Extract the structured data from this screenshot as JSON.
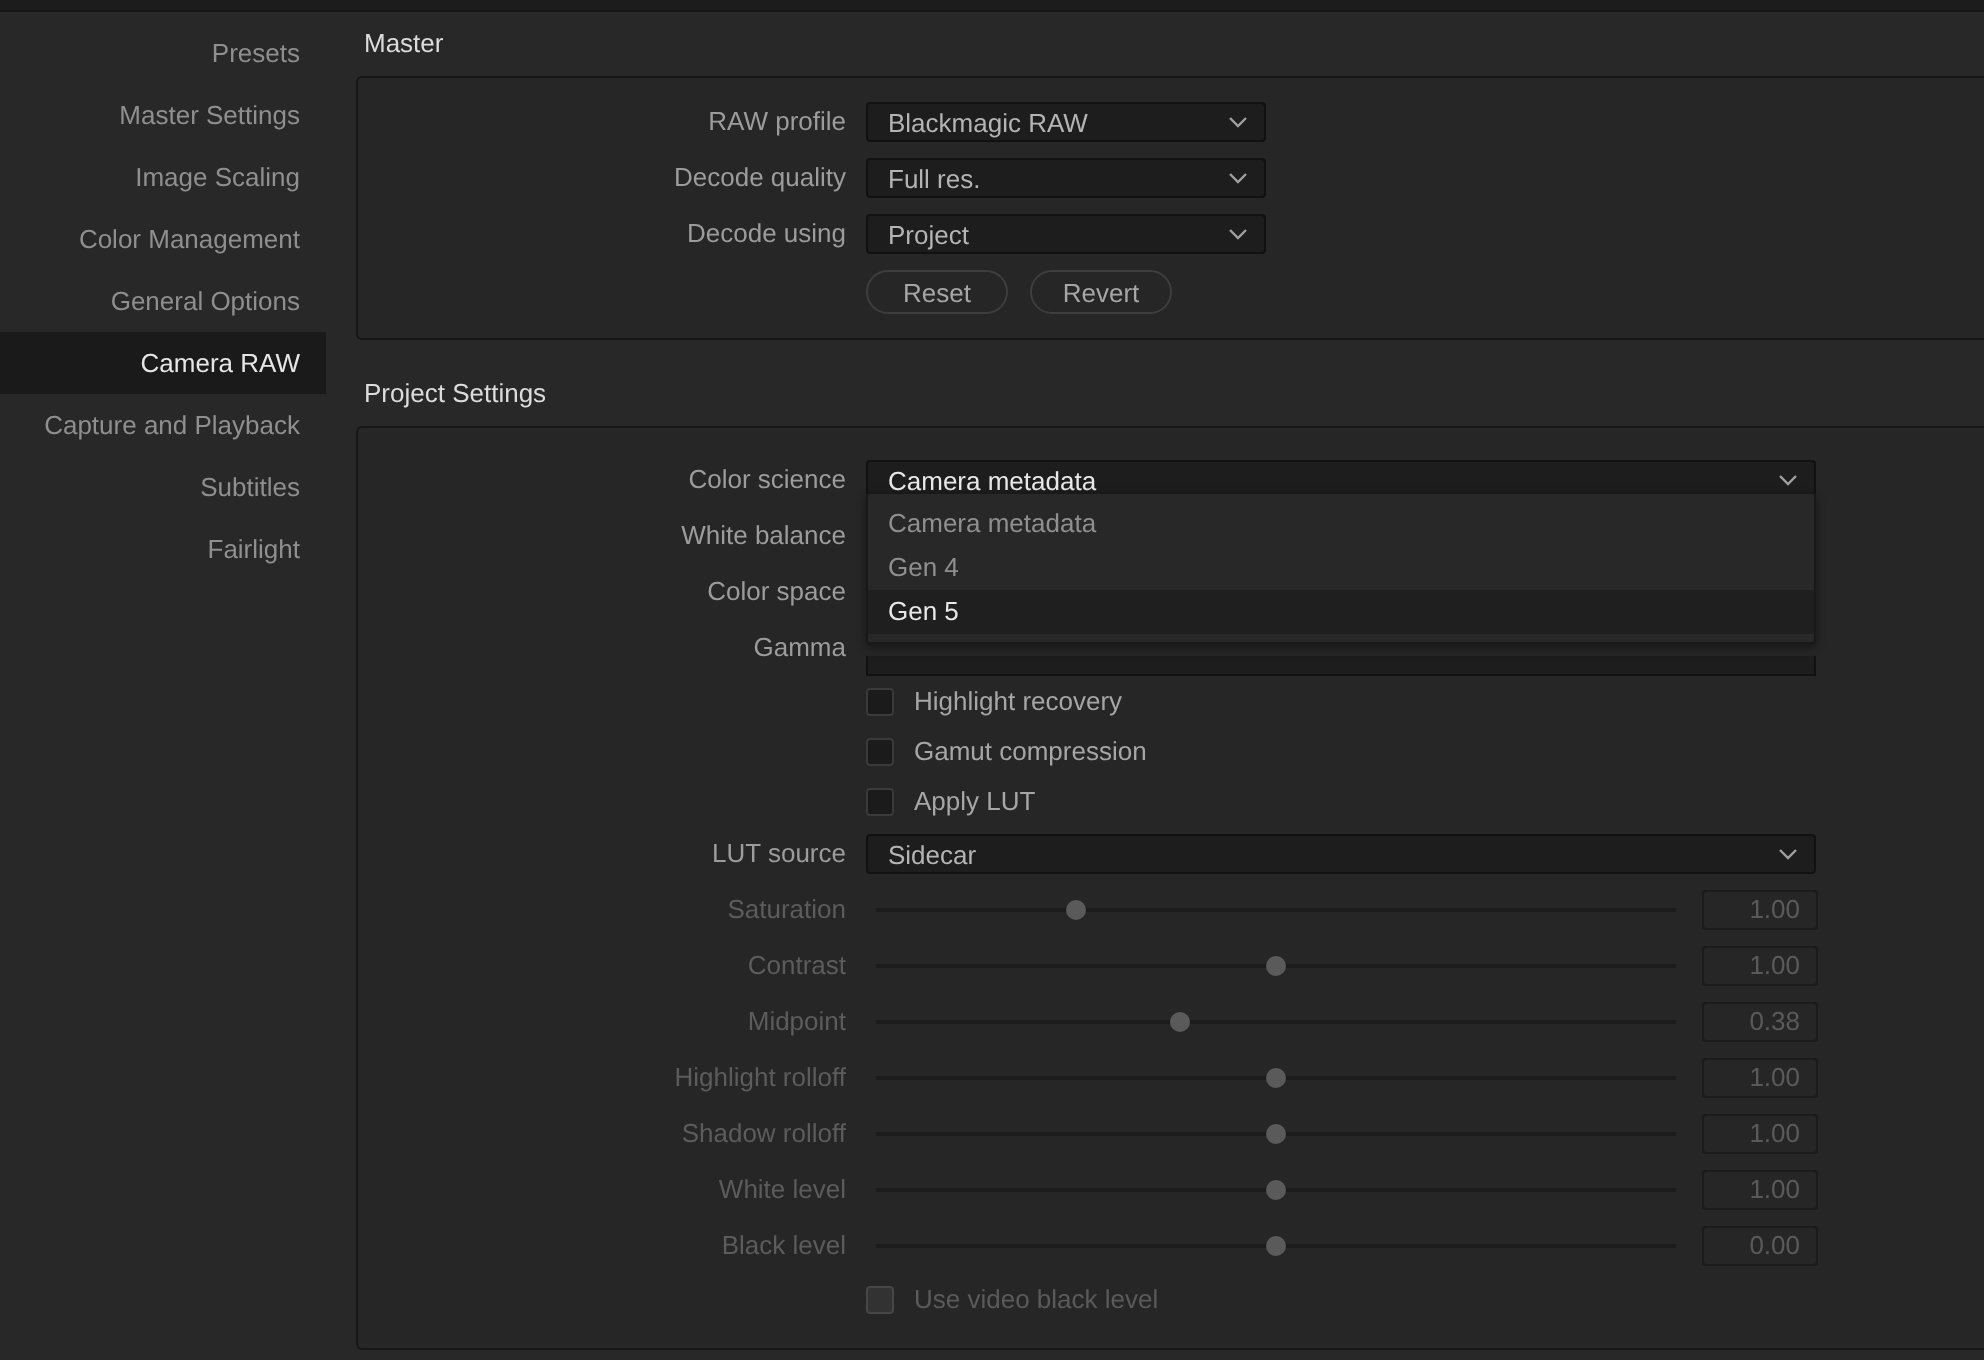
{
  "sidebar": {
    "items": [
      {
        "label": "Presets",
        "selected": false
      },
      {
        "label": "Master Settings",
        "selected": false
      },
      {
        "label": "Image Scaling",
        "selected": false
      },
      {
        "label": "Color Management",
        "selected": false
      },
      {
        "label": "General Options",
        "selected": false
      },
      {
        "label": "Camera RAW",
        "selected": true
      },
      {
        "label": "Capture and Playback",
        "selected": false
      },
      {
        "label": "Subtitles",
        "selected": false
      },
      {
        "label": "Fairlight",
        "selected": false
      }
    ]
  },
  "master": {
    "title": "Master",
    "rows": [
      {
        "label": "RAW profile",
        "value": "Blackmagic RAW"
      },
      {
        "label": "Decode quality",
        "value": "Full res."
      },
      {
        "label": "Decode using",
        "value": "Project"
      }
    ],
    "buttons": [
      "Reset",
      "Revert"
    ]
  },
  "project_settings": {
    "title": "Project Settings",
    "rows": [
      {
        "kind": "dropdown",
        "label": "Color science",
        "value": "Camera metadata",
        "open": true,
        "options": [
          {
            "label": "Camera metadata",
            "highlighted": false
          },
          {
            "label": "Gen 4",
            "highlighted": false
          },
          {
            "label": "Gen 5",
            "highlighted": true
          }
        ]
      },
      {
        "kind": "covered",
        "label": "White balance"
      },
      {
        "kind": "covered",
        "label": "Color space"
      },
      {
        "kind": "covered",
        "label": "Gamma"
      },
      {
        "kind": "checkbox",
        "label": "Highlight recovery",
        "checked": false,
        "disabled": false
      },
      {
        "kind": "checkbox",
        "label": "Gamut compression",
        "checked": false,
        "disabled": false
      },
      {
        "kind": "checkbox",
        "label": "Apply LUT",
        "checked": false,
        "disabled": false
      },
      {
        "kind": "dropdown",
        "label": "LUT source",
        "value": "Sidecar",
        "open": false
      },
      {
        "kind": "slider",
        "label": "Saturation",
        "level": 0.25,
        "reading": "1.00",
        "disabled": true
      },
      {
        "kind": "slider",
        "label": "Contrast",
        "level": 0.5,
        "reading": "1.00",
        "disabled": true
      },
      {
        "kind": "slider",
        "label": "Midpoint",
        "level": 0.38,
        "reading": "0.38",
        "disabled": true
      },
      {
        "kind": "slider",
        "label": "Highlight rolloff",
        "level": 0.5,
        "reading": "1.00",
        "disabled": true
      },
      {
        "kind": "slider",
        "label": "Shadow rolloff",
        "level": 0.5,
        "reading": "1.00",
        "disabled": true
      },
      {
        "kind": "slider",
        "label": "White level",
        "level": 0.5,
        "reading": "1.00",
        "disabled": true
      },
      {
        "kind": "slider",
        "label": "Black level",
        "level": 0.5,
        "reading": "0.00",
        "disabled": true
      },
      {
        "kind": "checkbox",
        "label": "Use video black level",
        "checked": false,
        "disabled": true
      }
    ]
  }
}
